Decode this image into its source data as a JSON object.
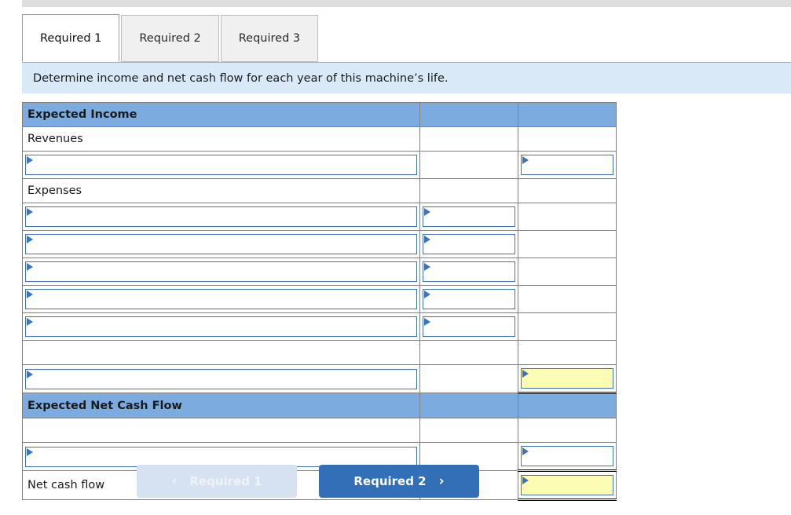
{
  "tabs": [
    {
      "label": "Required 1",
      "active": true
    },
    {
      "label": "Required 2",
      "active": false
    },
    {
      "label": "Required 3",
      "active": false
    }
  ],
  "banner": {
    "text": "Determine income and net cash flow for each year of this machine’s life."
  },
  "worksheet": {
    "columns": [
      "",
      "",
      ""
    ],
    "rows": [
      {
        "type": "section",
        "label": "Expected Income",
        "mid": "",
        "right": ""
      },
      {
        "type": "text",
        "label": "Revenues",
        "mid": "",
        "right": ""
      },
      {
        "type": "row",
        "label": "",
        "label_input": true,
        "mid_input": false,
        "right_input": true,
        "right_yellow": false
      },
      {
        "type": "text",
        "label": "Expenses",
        "mid": "",
        "right": ""
      },
      {
        "type": "row",
        "label": "",
        "label_input": true,
        "mid_input": true,
        "right_input": false
      },
      {
        "type": "row",
        "label": "",
        "label_input": true,
        "mid_input": true,
        "right_input": false
      },
      {
        "type": "row",
        "label": "",
        "label_input": true,
        "mid_input": true,
        "right_input": false
      },
      {
        "type": "row",
        "label": "",
        "label_input": true,
        "mid_input": true,
        "right_input": false
      },
      {
        "type": "row",
        "label": "",
        "label_input": true,
        "mid_input": true,
        "right_input": false
      },
      {
        "type": "row",
        "label": "",
        "label_input": false,
        "mid_input": false,
        "right_input": false
      },
      {
        "type": "row",
        "label": "",
        "label_input": true,
        "mid_input": false,
        "right_input": true,
        "right_yellow": true,
        "right_total": true
      },
      {
        "type": "section",
        "label": "Expected Net Cash Flow",
        "mid": "",
        "right": ""
      },
      {
        "type": "row",
        "label": "",
        "label_input": false,
        "mid_input": false,
        "right_input": false
      },
      {
        "type": "row",
        "label": "",
        "label_input": true,
        "mid_input": false,
        "right_input": true,
        "right_yellow": false,
        "right_total": true
      },
      {
        "type": "text_total",
        "label": "Net cash flow",
        "mid": "",
        "right_input": true,
        "right_yellow": true,
        "right_total": true
      }
    ]
  },
  "nav": {
    "prev_label": "Required 1",
    "prev_chevron": "‹",
    "next_label": "Required 2",
    "next_chevron": "›"
  },
  "colors": {
    "section_blue": "#7cacdf",
    "banner_blue": "#d9e9f8",
    "input_border": "#3d74b8",
    "highlight_yellow": "#fdfcb4",
    "primary_button": "#336fb7",
    "disabled_button": "#d6e2f2"
  }
}
